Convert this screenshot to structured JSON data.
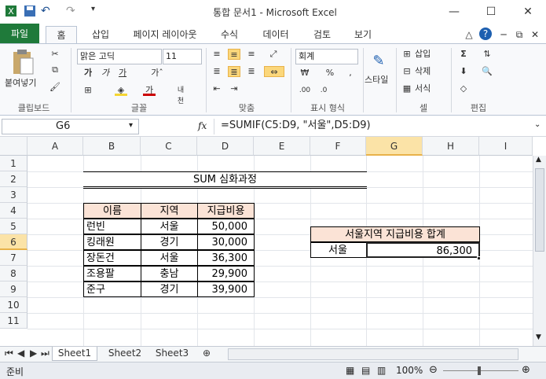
{
  "window": {
    "title": "통합 문서1 - Microsoft Excel"
  },
  "tabs": [
    "파일",
    "홈",
    "삽입",
    "페이지 레이아웃",
    "수식",
    "데이터",
    "검토",
    "보기"
  ],
  "ribbon": {
    "paste_label": "붙여넣기",
    "font_name": "맑은 고딕",
    "font_size": "11",
    "number_format": "회계",
    "style_label": "스타일",
    "insert_label": "삽입",
    "delete_label": "삭제",
    "format_label": "서식",
    "groups": [
      "클립보드",
      "글꼴",
      "맞춤",
      "표시 형식",
      "셀",
      "편집"
    ]
  },
  "formula_bar": {
    "name_box": "G6",
    "fx": "fx",
    "formula": "=SUMIF(C5:D9, \"서울\",D5:D9)"
  },
  "columns": [
    "A",
    "B",
    "C",
    "D",
    "E",
    "F",
    "G",
    "H",
    "I"
  ],
  "rows": [
    "1",
    "2",
    "3",
    "4",
    "5",
    "6",
    "7",
    "8",
    "9",
    "10",
    "11"
  ],
  "sheet": {
    "title": "SUM 심화과정",
    "headers": [
      "이름",
      "지역",
      "지급비용"
    ],
    "data": [
      [
        "런빈",
        "서울",
        "50,000"
      ],
      [
        "킹래원",
        "경기",
        "30,000"
      ],
      [
        "장돈건",
        "서울",
        "36,300"
      ],
      [
        "조용팔",
        "충남",
        "29,900"
      ],
      [
        "준구",
        "경기",
        "39,900"
      ]
    ],
    "summary_label": "서울지역 지급비용 합계",
    "criteria": "서울",
    "result": "86,300"
  },
  "sheet_tabs": [
    "Sheet1",
    "Sheet2",
    "Sheet3"
  ],
  "status": {
    "mode": "준비",
    "zoom": "100%"
  },
  "colors": {
    "accent": "#1f7a3a",
    "header_fill": "#fbe3d6",
    "selected": "#e8b24a"
  }
}
